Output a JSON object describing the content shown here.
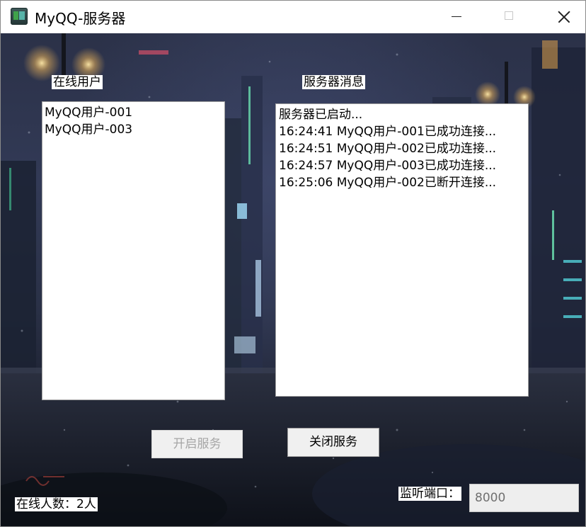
{
  "window": {
    "title": "MyQQ-服务器"
  },
  "labels": {
    "online_users": "在线用户",
    "server_messages": "服务器消息",
    "online_count": "在线人数：2人",
    "listen_port": "监听端口："
  },
  "online_users": [
    "MyQQ用户-001",
    "MyQQ用户-003"
  ],
  "server_messages": [
    "服务器已启动...",
    "16:24:41 MyQQ用户-001已成功连接...",
    "16:24:51 MyQQ用户-002已成功连接...",
    "16:24:57 MyQQ用户-003已成功连接...",
    "16:25:06 MyQQ用户-002已断开连接..."
  ],
  "buttons": {
    "start_service": "开启服务",
    "stop_service": "关闭服务"
  },
  "port": {
    "value": "8000"
  },
  "icons": {
    "app": "app-icon",
    "minimize": "minimize-icon",
    "maximize": "maximize-icon",
    "close": "close-icon"
  },
  "colors": {
    "disabled_text": "#a6a6a6",
    "background": "#2b3148"
  }
}
